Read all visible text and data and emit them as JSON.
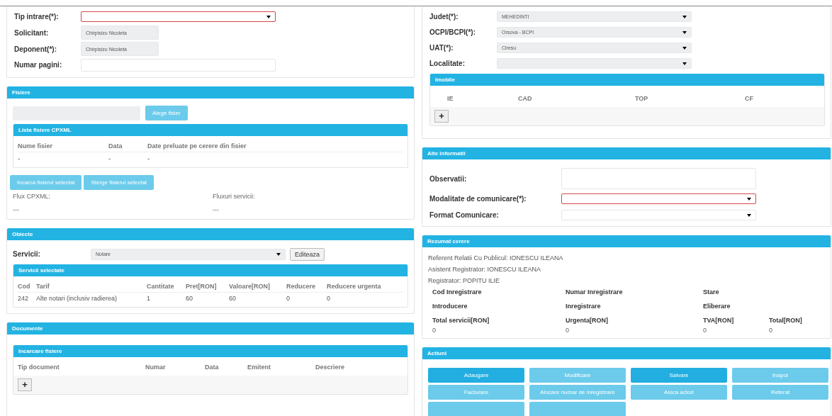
{
  "left": {
    "request_form": {
      "fields": [
        {
          "label": "Tip intrare(*):",
          "kind": "select",
          "invalid": true,
          "disabled": false
        },
        {
          "label": "Solicitant:",
          "kind": "text",
          "value": "Chirpisizu Nicoleta",
          "invalid": false,
          "disabled": true
        },
        {
          "label": "Deponent(*):",
          "kind": "text",
          "value": "Chirpisizu Nicoleta",
          "invalid": false,
          "disabled": true
        },
        {
          "label": "Numar pagini:",
          "kind": "text",
          "invalid": false,
          "disabled": false
        }
      ]
    },
    "fisiere": {
      "title": "Fisiere",
      "choose_button": {
        "label": "Alege fisier",
        "disabled": true
      },
      "cpxml_list": {
        "title": "Lista fisiere CPXML",
        "columns": [
          "Nume fisier",
          "Data",
          "Date preluate pe cerere din fisier"
        ],
        "rows": [
          [
            "-",
            "-",
            "-"
          ]
        ]
      },
      "buttons": [
        {
          "label": "Incarca fisierul selectat",
          "disabled": true
        },
        {
          "label": "Sterge fisierul selectat",
          "disabled": true
        }
      ],
      "flows": [
        {
          "label": "Flux CPXML:",
          "value": "---"
        },
        {
          "label": "Fluxuri servicii:",
          "value": "---"
        }
      ]
    },
    "obiecte": {
      "title": "Obiecte",
      "services_field": {
        "label": "Servicii:",
        "value": "Notare",
        "disabled": true
      },
      "edit_button": "Editeaza",
      "selected_services": {
        "title": "Servicii selectate",
        "columns": [
          "Cod",
          "Tarif",
          "Cantitate",
          "Pret[RON]",
          "Valoare[RON]",
          "Reducere",
          "Reducere urgenta"
        ],
        "rows": [
          [
            "242",
            "Alte notari (inclusiv radierea)",
            "1",
            "60",
            "60",
            "0",
            "0"
          ]
        ]
      }
    },
    "documente": {
      "title": "Documente",
      "upload": {
        "title": "Incarcare fisiere",
        "columns": [
          "Tip document",
          "Numar",
          "Data",
          "Emitent",
          "Descriere"
        ],
        "add_button": "+"
      }
    }
  },
  "right": {
    "location_form": {
      "fields": [
        {
          "label": "Judet(*):",
          "kind": "select",
          "value": "MEHEDINTI",
          "invalid": false,
          "disabled": true
        },
        {
          "label": "OCPI/BCPI(*):",
          "kind": "select",
          "value": "Orsova - BCPI",
          "invalid": false,
          "disabled": true
        },
        {
          "label": "UAT(*):",
          "kind": "select",
          "value": "Ciresu",
          "invalid": false,
          "disabled": true
        },
        {
          "label": "Localitate:",
          "kind": "select",
          "invalid": false,
          "disabled": true
        }
      ]
    },
    "imobile": {
      "title": "Imobile",
      "columns": [
        "IE",
        "CAD",
        "TOP",
        "CF"
      ],
      "add_button": "+"
    },
    "alte_informatii": {
      "title": "Alte informatii",
      "fields": [
        {
          "label": "Observatii:",
          "kind": "textarea",
          "invalid": false,
          "disabled": false
        },
        {
          "label": "Modalitate de comunicare(*):",
          "kind": "select",
          "invalid": true,
          "disabled": false
        },
        {
          "label": "Format Comunicare:",
          "kind": "select",
          "invalid": false,
          "disabled": false
        }
      ]
    },
    "rezumat": {
      "title": "Rezumat cerere",
      "lines": [
        "Referent Relatii Cu Publicul: IONESCU ILEANA",
        "Asistent Registrator: IONESCU ILEANA",
        "Registrator: POPITU ILIE"
      ],
      "grid": [
        {
          "kind": "label",
          "cells": [
            "Cod Inregistrare",
            "Numar Inregistrare",
            "Stare"
          ]
        },
        {
          "kind": "label",
          "cells": [
            "Introducere",
            "Inregistrare",
            "Eliberare"
          ]
        },
        {
          "kind": "label",
          "cells": [
            "Total servicii[RON]",
            "Urgenta[RON]",
            "TVA[RON]",
            "Total[RON]"
          ]
        },
        {
          "kind": "value",
          "cells": [
            "0",
            "0",
            "0",
            "0"
          ]
        }
      ]
    },
    "actiuni": {
      "title": "Actiuni",
      "buttons": [
        {
          "label": "Adaugare",
          "disabled": false
        },
        {
          "label": "Modificare",
          "disabled": true
        },
        {
          "label": "Salvare",
          "disabled": false
        },
        {
          "label": "Inapoi",
          "disabled": true
        },
        {
          "label": "Facturare",
          "disabled": true
        },
        {
          "label": "Alocare numar de inregistrare",
          "disabled": true
        },
        {
          "label": "Aloca actori",
          "disabled": true
        },
        {
          "label": "Referat",
          "disabled": true
        },
        {
          "disabled": true
        },
        {
          "disabled": true
        }
      ]
    }
  }
}
